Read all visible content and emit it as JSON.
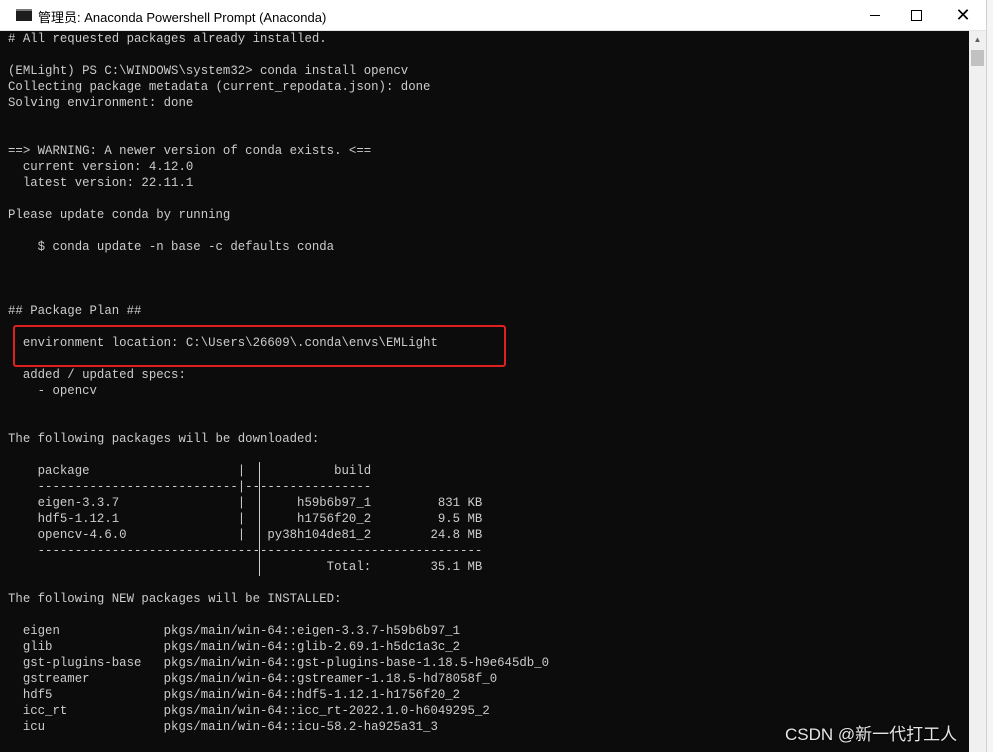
{
  "window": {
    "title": "管理员: Anaconda Powershell Prompt (Anaconda)",
    "icon": "console-icon",
    "controls": {
      "minimize": "minimize-icon",
      "maximize": "maximize-icon",
      "close": "✕"
    }
  },
  "terminal": {
    "lines": [
      "# All requested packages already installed.",
      "",
      "(EMLight) PS C:\\WINDOWS\\system32> conda install opencv",
      "Collecting package metadata (current_repodata.json): done",
      "Solving environment: done",
      "",
      "",
      "==> WARNING: A newer version of conda exists. <==",
      "  current version: 4.12.0",
      "  latest version: 22.11.1",
      "",
      "Please update conda by running",
      "",
      "    $ conda update -n base -c defaults conda",
      "",
      "",
      "",
      "## Package Plan ##",
      "",
      "  environment location: C:\\Users\\26609\\.conda\\envs\\EMLight",
      "",
      "  added / updated specs:",
      "    - opencv",
      "",
      "",
      "The following packages will be downloaded:",
      "",
      "    package                    |            build",
      "    ---------------------------|-----------------",
      "    eigen-3.3.7                |       h59b6b97_1         831 KB",
      "    hdf5-1.12.1                |       h1756f20_2         9.5 MB",
      "    opencv-4.6.0               |   py38h104de81_2        24.8 MB",
      "    ------------------------------------------------------------",
      "                                           Total:        35.1 MB",
      "",
      "The following NEW packages will be INSTALLED:",
      "",
      "  eigen              pkgs/main/win-64::eigen-3.3.7-h59b6b97_1",
      "  glib               pkgs/main/win-64::glib-2.69.1-h5dc1a3c_2",
      "  gst-plugins-base   pkgs/main/win-64::gst-plugins-base-1.18.5-h9e645db_0",
      "  gstreamer          pkgs/main/win-64::gstreamer-1.18.5-hd78058f_0",
      "  hdf5               pkgs/main/win-64::hdf5-1.12.1-h1756f20_2",
      "  icc_rt             pkgs/main/win-64::icc_rt-2022.1.0-h6049295_2",
      "  icu                pkgs/main/win-64::icu-58.2-ha925a31_3"
    ]
  },
  "scrollbar": {
    "up_arrow": "▲"
  },
  "watermark": "CSDN @新一代打工人",
  "colors": {
    "terminal_bg": "#0c0c0c",
    "terminal_fg": "#cccccc",
    "highlight": "#e02020"
  }
}
